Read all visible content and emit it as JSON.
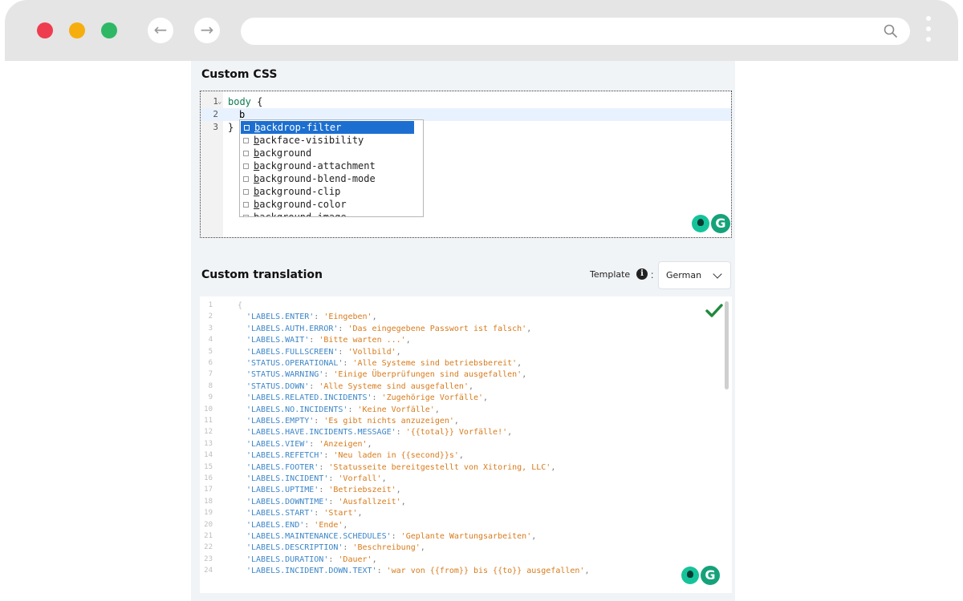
{
  "browser": {
    "back_icon": "←",
    "forward_icon": "→",
    "url": ""
  },
  "custom_css": {
    "title": "Custom CSS",
    "lines": [
      {
        "num": "1",
        "selector": "body",
        "brace": "{"
      },
      {
        "num": "2",
        "text": "b"
      },
      {
        "num": "3",
        "brace": "}"
      }
    ],
    "autocomplete": {
      "typed": "b",
      "items": [
        "backdrop-filter",
        "backface-visibility",
        "background",
        "background-attachment",
        "background-blend-mode",
        "background-clip",
        "background-color",
        "background-image"
      ],
      "selected_index": 0
    }
  },
  "custom_translation": {
    "title": "Custom translation",
    "template_label": "Template",
    "template_colon": ":",
    "info_icon": "i",
    "language": "German",
    "lines": [
      {
        "num": "1",
        "open": "{"
      },
      {
        "num": "2",
        "key": "'LABELS.ENTER'",
        "value": "'Eingeben'"
      },
      {
        "num": "3",
        "key": "'LABELS.AUTH.ERROR'",
        "value": "'Das eingegebene Passwort ist falsch'"
      },
      {
        "num": "4",
        "key": "'LABELS.WAIT'",
        "value": "'Bitte warten ...'"
      },
      {
        "num": "5",
        "key": "'LABELS.FULLSCREEN'",
        "value": "'Vollbild'"
      },
      {
        "num": "6",
        "key": "'STATUS.OPERATIONAL'",
        "value": "'Alle Systeme sind betriebsbereit'"
      },
      {
        "num": "7",
        "key": "'STATUS.WARNING'",
        "value": "'Einige Überprüfungen sind ausgefallen'"
      },
      {
        "num": "8",
        "key": "'STATUS.DOWN'",
        "value": "'Alle Systeme sind ausgefallen'"
      },
      {
        "num": "9",
        "key": "'LABELS.RELATED.INCIDENTS'",
        "value": "'Zugehörige Vorfälle'"
      },
      {
        "num": "10",
        "key": "'LABELS.NO.INCIDENTS'",
        "value": "'Keine Vorfälle'"
      },
      {
        "num": "11",
        "key": "'LABELS.EMPTY'",
        "value": "'Es gibt nichts anzuzeigen'"
      },
      {
        "num": "12",
        "key": "'LABELS.HAVE.INCIDENTS.MESSAGE'",
        "value": "'{{total}} Vorfälle!'"
      },
      {
        "num": "13",
        "key": "'LABELS.VIEW'",
        "value": "'Anzeigen'"
      },
      {
        "num": "14",
        "key": "'LABELS.REFETCH'",
        "value": "'Neu laden in {{second}}s'"
      },
      {
        "num": "15",
        "key": "'LABELS.FOOTER'",
        "value": "'Statusseite bereitgestellt von Xitoring, LLC'"
      },
      {
        "num": "16",
        "key": "'LABELS.INCIDENT'",
        "value": "'Vorfall'"
      },
      {
        "num": "17",
        "key": "'LABELS.UPTIME'",
        "value": "'Betriebszeit'"
      },
      {
        "num": "18",
        "key": "'LABELS.DOWNTIME'",
        "value": "'Ausfallzeit'"
      },
      {
        "num": "19",
        "key": "'LABELS.START'",
        "value": "'Start'"
      },
      {
        "num": "20",
        "key": "'LABELS.END'",
        "value": "'Ende'"
      },
      {
        "num": "21",
        "key": "'LABELS.MAINTENANCE.SCHEDULES'",
        "value": "'Geplante Wartungsarbeiten'"
      },
      {
        "num": "22",
        "key": "'LABELS.DESCRIPTION'",
        "value": "'Beschreibung'"
      },
      {
        "num": "23",
        "key": "'LABELS.DURATION'",
        "value": "'Dauer'"
      },
      {
        "num": "24",
        "key": "'LABELS.INCIDENT.DOWN.TEXT'",
        "value": "'war von {{from}} bis {{to}} ausgefallen'"
      }
    ]
  },
  "colors": {
    "json_key": "#3d86c8",
    "json_value": "#d77b1c",
    "autocomplete_selected": "#1c6fd0",
    "valid_check": "#1f8a3c",
    "grammarly": "#15c39a"
  }
}
